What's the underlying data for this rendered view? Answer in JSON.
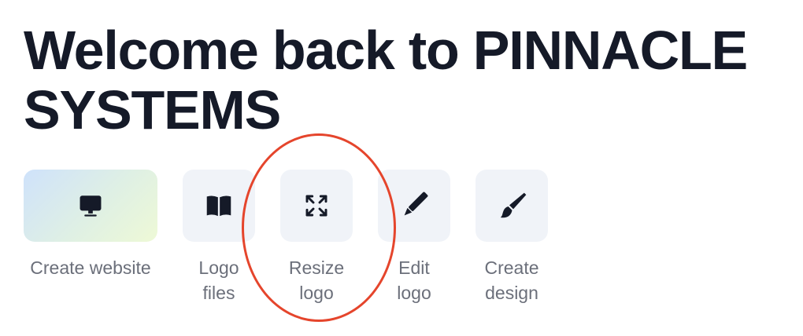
{
  "header": {
    "title_line1": "Welcome back to PINNACLE",
    "title_line2": "SYSTEMS"
  },
  "actions": [
    {
      "id": "create-website",
      "label_lines": [
        "Create website"
      ],
      "icon": "monitor-icon"
    },
    {
      "id": "logo-files",
      "label_lines": [
        "Logo",
        "files"
      ],
      "icon": "book-icon"
    },
    {
      "id": "resize-logo",
      "label_lines": [
        "Resize",
        "logo"
      ],
      "icon": "expand-arrows-icon"
    },
    {
      "id": "edit-logo",
      "label_lines": [
        "Edit",
        "logo"
      ],
      "icon": "pencil-icon"
    },
    {
      "id": "create-design",
      "label_lines": [
        "Create",
        "design"
      ],
      "icon": "paintbrush-icon"
    }
  ],
  "colors": {
    "title": "#151a28",
    "label": "#6b6f7a",
    "tile_bg": "#f0f3f8",
    "highlight": "#e5452c"
  }
}
